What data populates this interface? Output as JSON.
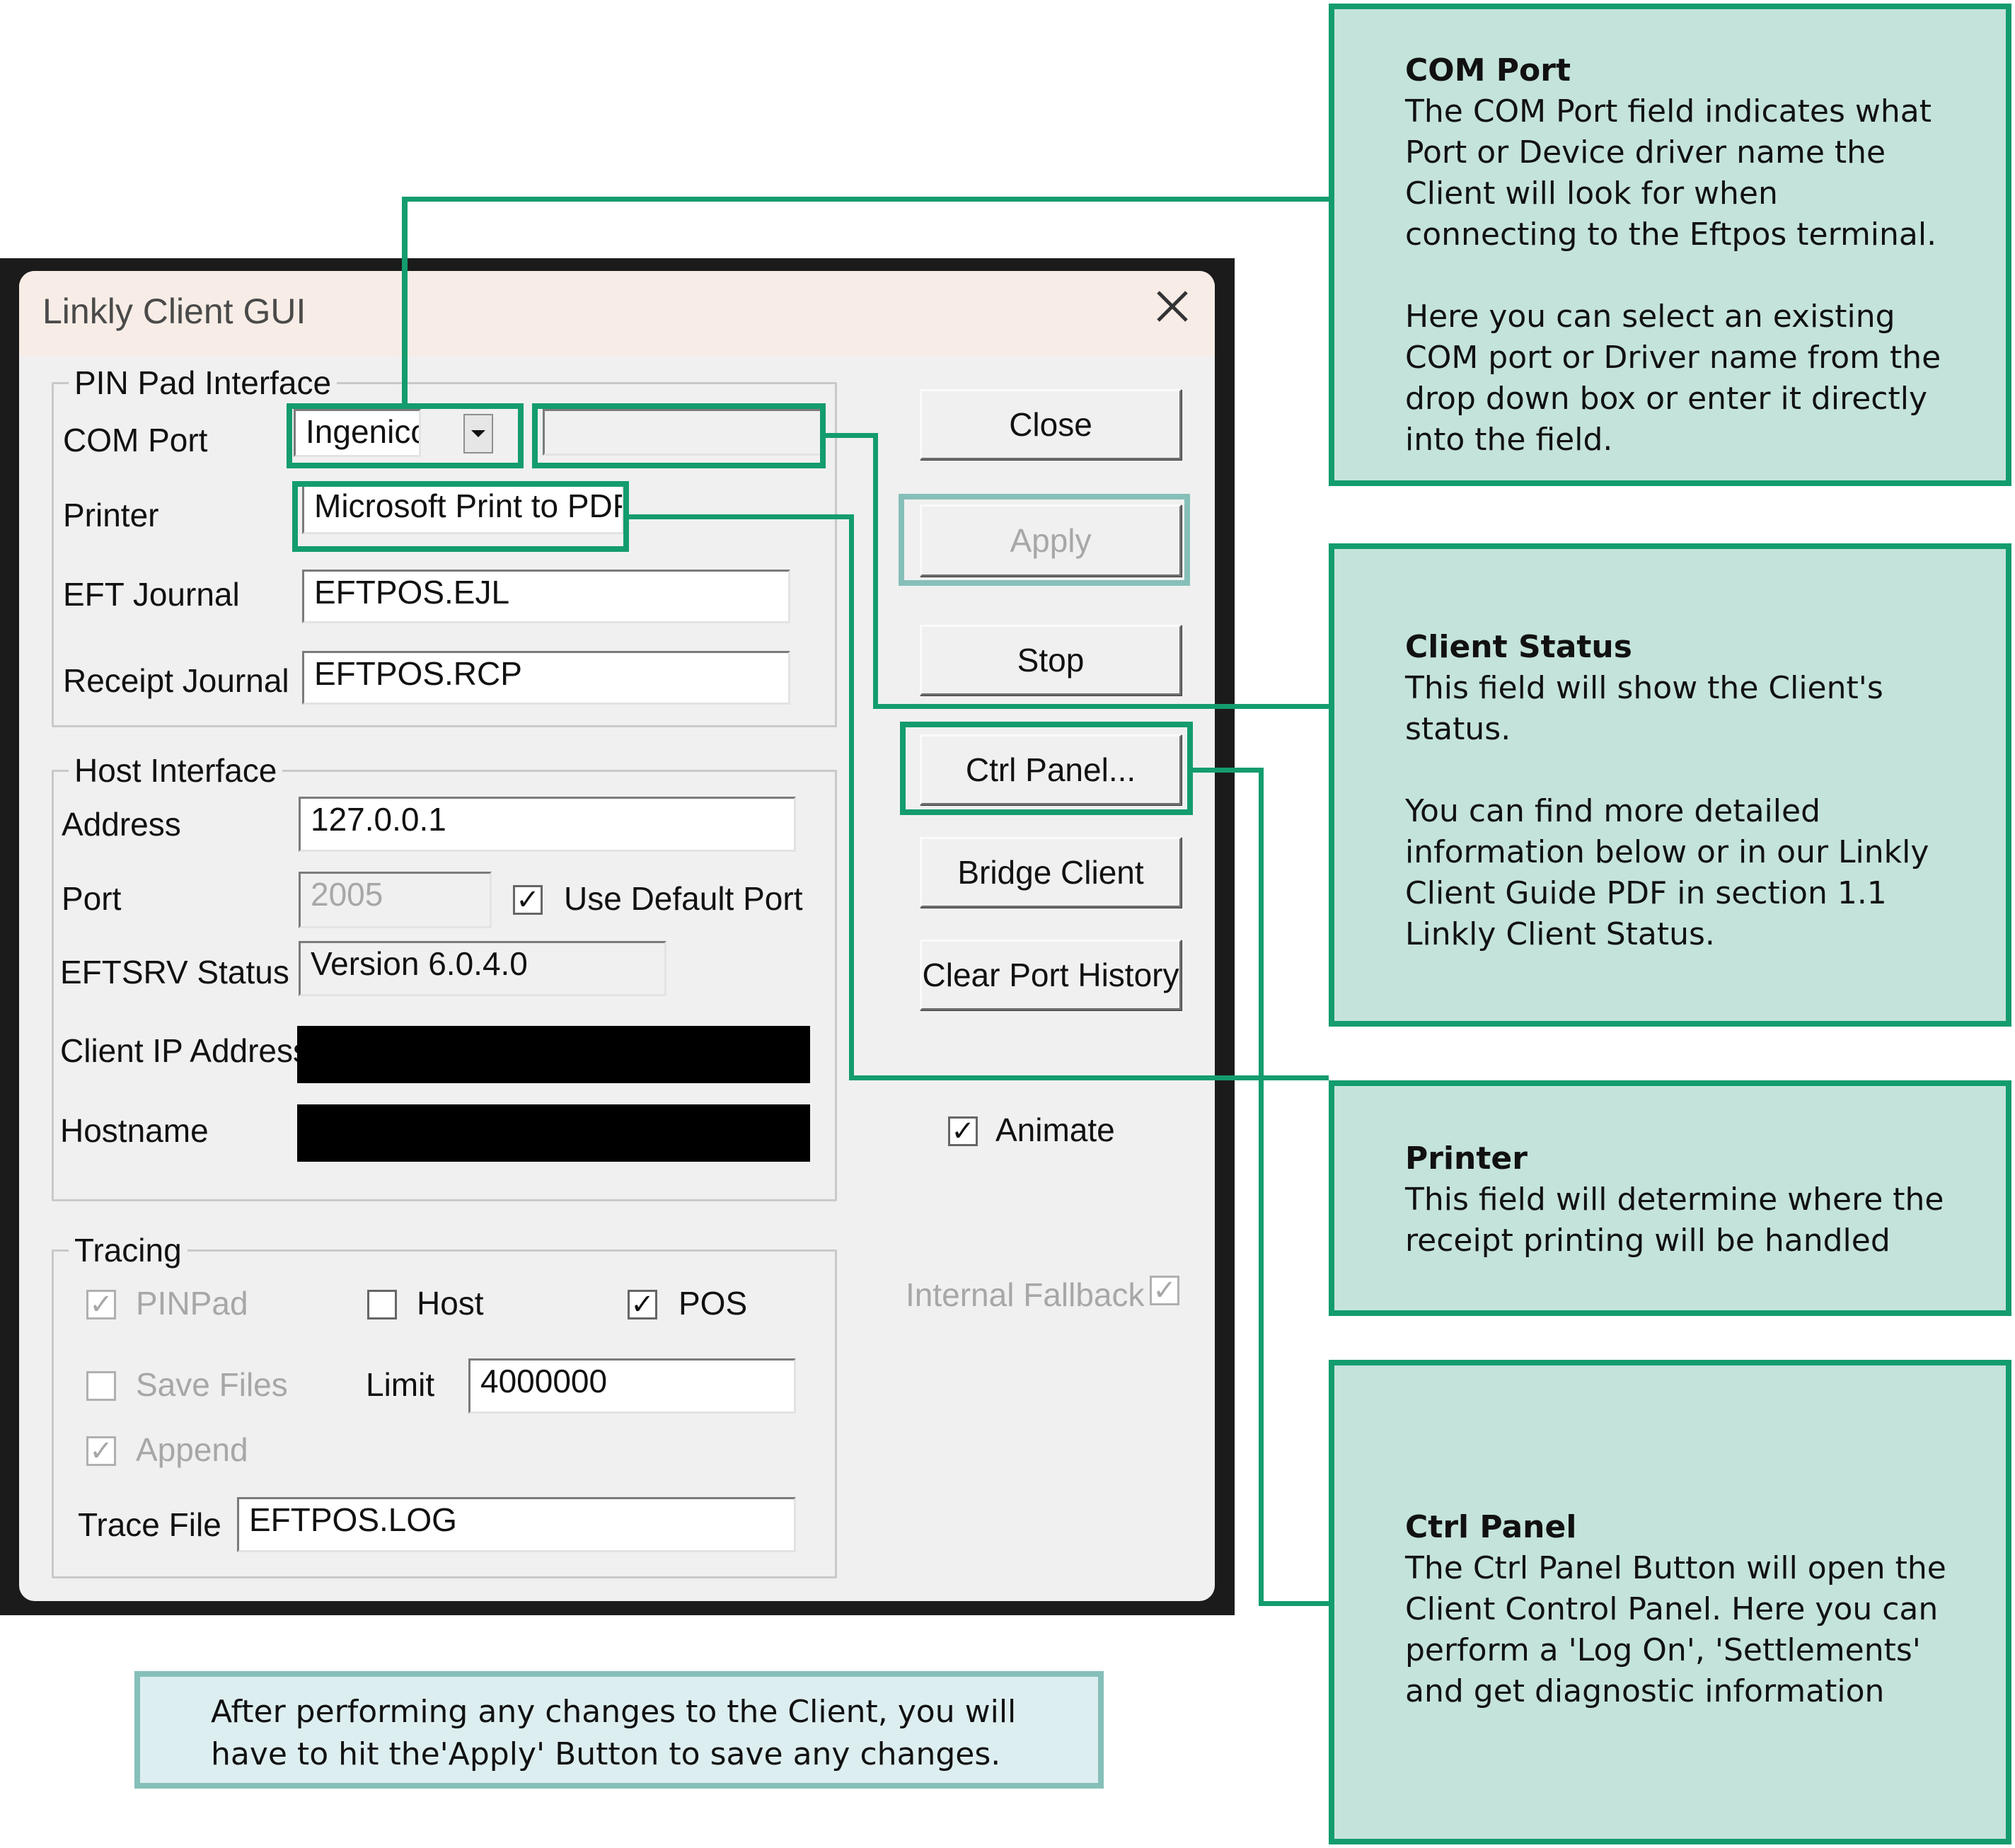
{
  "dialog": {
    "title": "Linkly Client GUI",
    "close_icon": "close-icon",
    "pinpad": {
      "legend": "PIN Pad Interface",
      "com_port_label": "COM Port",
      "com_port_value": "Ingenico;S",
      "client_status_value": "",
      "printer_label": "Printer",
      "printer_value": "Microsoft Print to PDF",
      "eft_journal_label": "EFT Journal",
      "eft_journal_value": "EFTPOS.EJL",
      "receipt_journal_label": "Receipt Journal",
      "receipt_journal_value": "EFTPOS.RCP"
    },
    "host": {
      "legend": "Host Interface",
      "address_label": "Address",
      "address_value": "127.0.0.1",
      "port_label": "Port",
      "port_value": "2005",
      "use_default_port_label": "Use Default Port",
      "use_default_port_checked": true,
      "eftsrv_status_label": "EFTSRV Status",
      "eftsrv_status_value": "Version 6.0.4.0",
      "client_ip_label": "Client IP Address",
      "hostname_label": "Hostname"
    },
    "tracing": {
      "legend": "Tracing",
      "pinpad_label": "PINPad",
      "host_label": "Host",
      "pos_label": "POS",
      "save_files_label": "Save Files",
      "limit_label": "Limit",
      "limit_value": "4000000",
      "append_label": "Append",
      "trace_file_label": "Trace File",
      "trace_file_value": "EFTPOS.LOG"
    },
    "buttons": {
      "close": "Close",
      "apply": "Apply",
      "stop": "Stop",
      "ctrl_panel": "Ctrl Panel...",
      "bridge_client": "Bridge Client",
      "clear_port_history": "Clear Port History"
    },
    "animate_label": "Animate",
    "internal_fallback_label": "Internal Fallback"
  },
  "callouts": {
    "com_port": {
      "title": "COM Port",
      "body": "The COM Port field indicates what\nPort or Device driver name the\nClient will look for when\nconnecting to the Eftpos terminal.\n\nHere you can select an existing\nCOM port or Driver name from the\ndrop down box or enter it directly\ninto the field."
    },
    "client_status": {
      "title": "Client Status",
      "body": "This field will show the Client's\nstatus.\n\nYou can find more detailed\ninformation below or in our Linkly\nClient Guide PDF in section 1.1\nLinkly Client Status."
    },
    "printer": {
      "title": "Printer",
      "body": "This field will determine where the\nreceipt printing will be handled"
    },
    "ctrl_panel": {
      "title": "Ctrl Panel",
      "body": "The Ctrl Panel Button will open the\nClient Control Panel. Here you can\nperform a 'Log On', 'Settlements'\nand get diagnostic information"
    }
  },
  "note": {
    "line1": "After performing any changes to the Client, you will",
    "line2": "have to hit the'Apply' Button to save any changes."
  }
}
